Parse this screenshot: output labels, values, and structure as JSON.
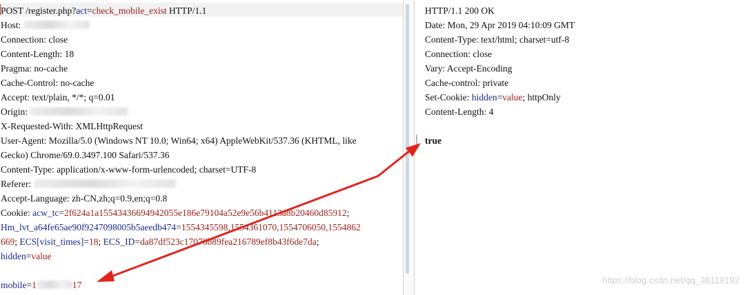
{
  "request": {
    "line1": {
      "pre": "POST /register.php?",
      "key": "act",
      "eq": "=",
      "val": "check_mobile_exist",
      "post": " HTTP/1.1"
    },
    "host": "Host: ",
    "connection": "Connection: close",
    "content_length": "Content-Length: 18",
    "pragma": "Pragma: no-cache",
    "cache_control": "Cache-Control: no-cache",
    "accept": "Accept: text/plain, */*; q=0.01",
    "origin": "Origin: ",
    "x_requested_with": "X-Requested-With: XMLHttpRequest",
    "user_agent_1": "User-Agent: Mozilla/5.0 (Windows NT 10.0; Win64; x64) AppleWebKit/537.36 (KHTML, like",
    "user_agent_2": "Gecko) Chrome/69.0.3497.100 Safari/537.36",
    "content_type": "Content-Type: application/x-www-form-urlencoded; charset=UTF-8",
    "referer": "Referer: ",
    "accept_language": "Accept-Language: zh-CN,zh;q=0.9,en;q=0.8",
    "cookie": {
      "label": "Cookie: ",
      "k1": "acw_tc",
      "v1": "2f624a1a15543436694942055e186e79104a52e9e56b4113a8b20460d85912",
      "k2": "Hm_lvt_a64fe65ae90f9247098005b5aeedb474",
      "v2a": "1554345598,1554361070,1554706050,1554862",
      "v2b": "669",
      "k3": "ECS[visit_times]",
      "v3": "18",
      "k4": "ECS_ID",
      "v4": "da87df523c17076b89fea216789ef8b43f6de7da",
      "k5": "hidden",
      "v5": "value"
    },
    "body": {
      "key": "mobile",
      "val_pre": "1",
      "val_post": "17"
    }
  },
  "response": {
    "status": "HTTP/1.1 200 OK",
    "date": "Date: Mon, 29 Apr 2019 04:10:09 GMT",
    "content_type": "Content-Type: text/html; charset=utf-8",
    "connection": "Connection: close",
    "vary": "Vary: Accept-Encoding",
    "cache_control": "Cache-control: private",
    "set_cookie": {
      "label": "Set-Cookie: ",
      "key": "hidden",
      "val": "value",
      "post": "; httpOnly"
    },
    "content_length": "Content-Length: 4",
    "body": "true"
  },
  "watermark": "https://blog.csdn.net/qq_36119192",
  "colors": {
    "key_blue": "#1a2a8a",
    "value_red": "#a0201a",
    "arrow_red": "#e0241c"
  },
  "icons": {
    "arrows": "red-annotation-arrow-icon"
  }
}
